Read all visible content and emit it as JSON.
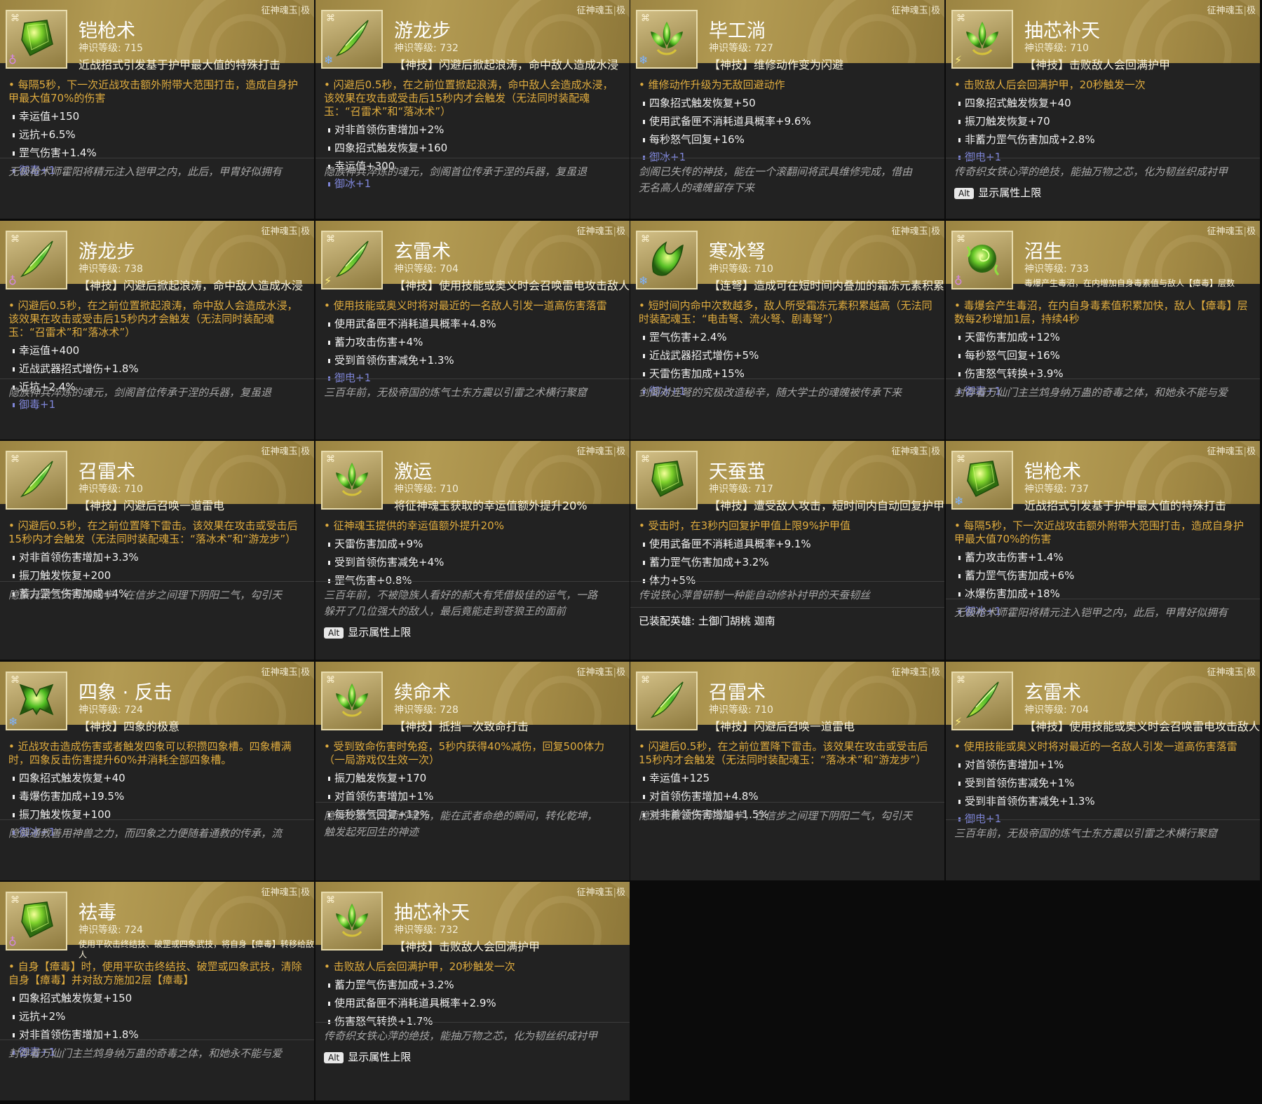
{
  "ui": {
    "tier_label": "征神魂玉",
    "tier_sep": "|",
    "tier_grade": "极",
    "alt_key": "Alt",
    "alt_text": "显示属性上限"
  },
  "cards": [
    {
      "name": "铠枪术",
      "level": "神识等级: 715",
      "subtitle": "近战招式引发基于护甲最大值的特殊打击",
      "gem": "armor",
      "element": "poison",
      "main": "• 每隔5秒，下一次近战攻击额外附带大范围打击，造成自身护甲最大值70%的伤害",
      "stats": [
        "幸运值+150",
        "远抗+6.5%",
        "罡气伤害+1.4%"
      ],
      "affix": "御毒+1",
      "lore": [
        "无极枪术师霍阳将精元注入铠甲之内，此后，甲胄好似拥有"
      ],
      "footer": ""
    },
    {
      "name": "游龙步",
      "level": "神识等级: 732",
      "subtitle": "【神技】闪避后掀起浪涛，命中敌人造成水浸",
      "gem": "blade",
      "element": "ice",
      "main": "• 闪避后0.5秒，在之前位置掀起浪涛，命中敌人会造成水浸，该效果在攻击或受击后15秒内才会触发（无法同时装配魂玉：“召雷术”和“落冰术”）",
      "stats": [
        "对非首领伤害增加+2%",
        "四象招式触发恢复+160",
        "幸运值+300"
      ],
      "affix": "御冰+1",
      "lore": [
        "隐族神兵淬炼的魂元，剑阁首位传承于涅的兵器，复虽退"
      ],
      "footer": ""
    },
    {
      "name": "毕工淌",
      "level": "神识等级: 727",
      "subtitle": "【神技】维修动作变为闪避",
      "gem": "lotus",
      "element": "ice",
      "main": "• 维修动作升级为无敌回避动作",
      "stats": [
        "四象招式触发恢复+50",
        "使用武备匣不消耗道具概率+9.6%",
        "每秒怒气回复+16%"
      ],
      "affix": "御冰+1",
      "lore": [
        "剑阁已失传的神技，能在一个滚翻间将武具维修完成，借由",
        "无名高人的魂魄留存下来"
      ],
      "footer": ""
    },
    {
      "name": "抽芯补天",
      "level": "神识等级: 710",
      "subtitle": "【神技】击败敌人会回满护甲",
      "gem": "lotus",
      "element": "thunder",
      "main": "• 击败敌人后会回满护甲，20秒触发一次",
      "stats": [
        "四象招式触发恢复+40",
        "振刀触发恢复+70",
        "非蓄力罡气伤害加成+2.8%"
      ],
      "affix": "御电+1",
      "lore": [
        "传奇织女铁心萍的绝技，能抽万物之芯，化为韧丝织成衬甲"
      ],
      "footer": "alt"
    },
    {
      "name": "游龙步",
      "level": "神识等级: 738",
      "subtitle": "【神技】闪避后掀起浪涛，命中敌人造成水浸",
      "gem": "blade",
      "element": "poison",
      "main": "• 闪避后0.5秒，在之前位置掀起浪涛，命中敌人会造成水浸，该效果在攻击或受击后15秒内才会触发（无法同时装配魂玉：“召雷术”和“落冰术”）",
      "stats": [
        "幸运值+400",
        "近战武器招式增伤+1.8%",
        "近抗+2.4%"
      ],
      "affix": "御毒+1",
      "lore": [
        "隐族神兵淬炼的魂元，剑阁首位传承于涅的兵器，复虽退"
      ],
      "footer": ""
    },
    {
      "name": "玄雷术",
      "level": "神识等级: 704",
      "subtitle": "【神技】使用技能或奥义时会召唤雷电攻击敌人",
      "gem": "blade",
      "element": "thunder",
      "main": "• 使用技能或奥义时将对最近的一名敌人引发一道高伤害落雷",
      "stats": [
        "使用武备匣不消耗道具概率+4.8%",
        "蓄力攻击伤害+4%",
        "受到首领伤害减免+1.3%"
      ],
      "affix": "御电+1",
      "lore": [
        "三百年前，无极帝国的炼气士东方震以引雷之术横行聚窟"
      ],
      "footer": ""
    },
    {
      "name": "寒冰弩",
      "level": "神识等级: 710",
      "subtitle": "【连弩】造成可在短时间内叠加的霜冻元素积累",
      "gem": "claw",
      "element": "ice",
      "main": "• 短时间内命中次数越多，敌人所受霜冻元素积累越高（无法同时装配魂玉：“电击弩、流火弩、剧毒弩”）",
      "stats": [
        "罡气伤害+2.4%",
        "近战武器招式增伤+5%",
        "天雷伤害加成+15%"
      ],
      "affix": "御冰+1",
      "lore": [
        "剑阁对连弩的究极改造秘辛，随大学士的魂魄被传承下来"
      ],
      "footer": ""
    },
    {
      "name": "沼生",
      "level": "神识等级: 733",
      "subtitle": "毒爆产生毒沼，在内增加自身毒素值与敌人【瘴毒】层数",
      "gem": "swirl",
      "element": "poison",
      "small": true,
      "main": "• 毒爆会产生毒沼，在内自身毒素值积累加快，敌人【瘴毒】层数每2秒增加1层，持续4秒",
      "stats": [
        "天雷伤害加成+12%",
        "每秒怒气回复+16%",
        "伤害怒气转换+3.9%"
      ],
      "affix": "御毒+1",
      "lore": [
        "封存着万仙门主兰鸩身纳万蛊的奇毒之体，和她永不能与爱"
      ],
      "footer": ""
    },
    {
      "name": "召雷术",
      "level": "神识等级: 710",
      "subtitle": "【神技】闪避后召唤一道雷电",
      "gem": "blade",
      "element": "",
      "main": "• 闪避后0.5秒，在之前位置降下雷击。该效果在攻击或受击后15秒内才会触发（无法同时装配魂玉：“落冰术”和“游龙步”）",
      "stats": [
        "对非首领伤害增加+3.3%",
        "振刀触发恢复+200",
        "蓄力罡气伤害加成+4%"
      ],
      "affix": "",
      "lore": [
        "隐族元教玄天师的绝学，在信步之间理下阴阳二气，勾引天"
      ],
      "footer": ""
    },
    {
      "name": "激运",
      "level": "神识等级: 710",
      "subtitle": "将征神魂玉获取的幸运值额外提升20%",
      "gem": "lotus",
      "element": "",
      "main": "• 征神魂玉提供的幸运值额外提升20%",
      "stats": [
        "天雷伤害加成+9%",
        "受到首领伤害减免+4%",
        "罡气伤害+0.8%"
      ],
      "affix": "",
      "lore": [
        "三百年前，不被隐族人看好的郝大有凭借极佳的运气，一路",
        "躲开了几位强大的敌人，最后竟能走到苍狼王的面前"
      ],
      "footer": "alt"
    },
    {
      "name": "天蚕茧",
      "level": "神识等级: 717",
      "subtitle": "【神技】遭受敌人攻击，短时间内自动回复护甲值",
      "gem": "armor",
      "element": "",
      "main": "• 受击时，在3秒内回复护甲值上限9%护甲值",
      "stats": [
        "使用武备匣不消耗道具概率+9.1%",
        "蓄力罡气伤害加成+3.2%",
        "体力+5%"
      ],
      "affix": "",
      "lore": [
        "传说铁心萍曾研制一种能自动修补衬甲的天蚕韧丝"
      ],
      "footer": "equip",
      "equip": "已装配英雄: 土御门胡桃 迦南"
    },
    {
      "name": "铠枪术",
      "level": "神识等级: 737",
      "subtitle": "近战招式引发基于护甲最大值的特殊打击",
      "gem": "armor",
      "element": "ice",
      "main": "• 每隔5秒，下一次近战攻击额外附带大范围打击，造成自身护甲最大值70%的伤害",
      "stats": [
        "蓄力攻击伤害+1.4%",
        "蓄力罡气伤害加成+6%",
        "冰爆伤害加成+18%"
      ],
      "affix": "御冰+1",
      "lore": [
        "无极枪术师霍阳将精元注入铠甲之内，此后，甲胄好似拥有"
      ],
      "footer": ""
    },
    {
      "name": "四象 · 反击",
      "level": "神识等级: 724",
      "subtitle": "【神技】四象的极意",
      "gem": "beast",
      "element": "ice",
      "main": "• 近战攻击造成伤害或者触发四象可以积攒四象槽。四象槽满时，四象反击伤害提升60%并消耗全部四象槽。",
      "stats": [
        "四象招式触发恢复+40",
        "毒爆伤害加成+19.5%",
        "振刀触发恢复+100"
      ],
      "affix": "御冰+1",
      "lore": [
        "隐族通教善用神兽之力，而四象之力便随着通教的传承，流"
      ],
      "footer": ""
    },
    {
      "name": "续命术",
      "level": "神识等级: 728",
      "subtitle": "【神技】抵挡一次致命打击",
      "gem": "lotus",
      "element": "",
      "main": "• 受到致命伤害时免疫，5秒内获得40%减伤，回复500体力（一局游戏仅生效一次）",
      "stats": [
        "振刀触发恢复+170",
        "对首领伤害增加+1%",
        "每秒怒气回复+12%"
      ],
      "affix": "",
      "lore": [
        "隐族元教玄天师的魂元，能在武者命绝的瞬间，转化乾坤，",
        "触发起死回生的神迹"
      ],
      "footer": ""
    },
    {
      "name": "召雷术",
      "level": "神识等级: 710",
      "subtitle": "【神技】闪避后召唤一道雷电",
      "gem": "blade",
      "element": "",
      "main": "• 闪避后0.5秒，在之前位置降下雷击。该效果在攻击或受击后15秒内才会触发（无法同时装配魂玉：“落冰术”和“游龙步”）",
      "stats": [
        "幸运值+125",
        "对首领伤害增加+4.8%",
        "对非首领伤害增加+1.5%"
      ],
      "affix": "",
      "lore": [
        "隐族元教玄天师的绝学，在信步之间理下阴阳二气，勾引天"
      ],
      "footer": ""
    },
    {
      "name": "玄雷术",
      "level": "神识等级: 704",
      "subtitle": "【神技】使用技能或奥义时会召唤雷电攻击敌人",
      "gem": "blade",
      "element": "thunder",
      "main": "• 使用技能或奥义时将对最近的一名敌人引发一道高伤害落雷",
      "stats": [
        "对首领伤害增加+1%",
        "受到首领伤害减免+1%",
        "受到非首领伤害减免+1.3%"
      ],
      "affix": "御电+1",
      "lore": [
        "三百年前，无极帝国的炼气士东方震以引雷之术横行聚窟"
      ],
      "footer": ""
    },
    {
      "name": "祛毒",
      "level": "神识等级: 724",
      "subtitle": "使用平砍击终结技、破罡或四象武技，将自身【瘴毒】转移给敌人",
      "gem": "armor",
      "element": "poison",
      "small": true,
      "main": "• 自身【瘴毒】时，使用平砍击终结技、破罡或四象武技，清除自身【瘴毒】并对敌方施加2层【瘴毒】",
      "stats": [
        "四象招式触发恢复+150",
        "远抗+2%",
        "对非首领伤害增加+1.8%"
      ],
      "affix": "御毒+1",
      "lore": [
        "封存着万仙门主兰鸩身纳万蛊的奇毒之体，和她永不能与爱"
      ],
      "footer": ""
    },
    {
      "name": "抽芯补天",
      "level": "神识等级: 732",
      "subtitle": "【神技】击败敌人会回满护甲",
      "gem": "lotus",
      "element": "",
      "main": "• 击败敌人后会回满护甲，20秒触发一次",
      "stats": [
        "蓄力罡气伤害加成+3.2%",
        "使用武备匣不消耗道具概率+2.9%",
        "伤害怒气转换+1.7%"
      ],
      "affix": "",
      "lore": [
        "传奇织女铁心萍的绝技，能抽万物之芯，化为韧丝织成衬甲"
      ],
      "footer": "alt"
    }
  ]
}
